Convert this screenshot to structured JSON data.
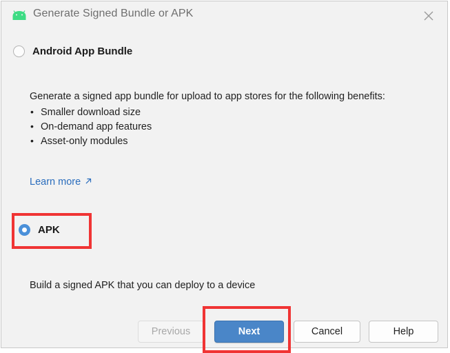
{
  "window": {
    "title": "Generate Signed Bundle or APK",
    "app_icon": "android-robot-icon",
    "close_icon": "close-icon",
    "background_color": "#f2f2f2",
    "border_color": "#c8c8c8"
  },
  "options": [
    {
      "id": "android-app-bundle",
      "label": "Android App Bundle",
      "selected": false
    },
    {
      "id": "apk",
      "label": "APK",
      "selected": true
    }
  ],
  "bundle_section": {
    "intro": "Generate a signed app bundle for upload to app stores for the following benefits:",
    "benefits": [
      "Smaller download size",
      "On-demand app features",
      "Asset-only modules"
    ],
    "link": {
      "label": "Learn more",
      "icon": "external-link-arrow-icon",
      "color": "#2a6dbd"
    }
  },
  "apk_section": {
    "description": "Build a signed APK that you can deploy to a device"
  },
  "buttons": {
    "previous": {
      "label": "Previous",
      "disabled": true
    },
    "next": {
      "label": "Next",
      "primary": true,
      "color": "#4a86c8"
    },
    "cancel": {
      "label": "Cancel",
      "disabled": false
    },
    "help": {
      "label": "Help",
      "disabled": false
    }
  },
  "annotations": {
    "color": "#f03434",
    "highlights": [
      "apk-radio-option",
      "next-button"
    ]
  }
}
